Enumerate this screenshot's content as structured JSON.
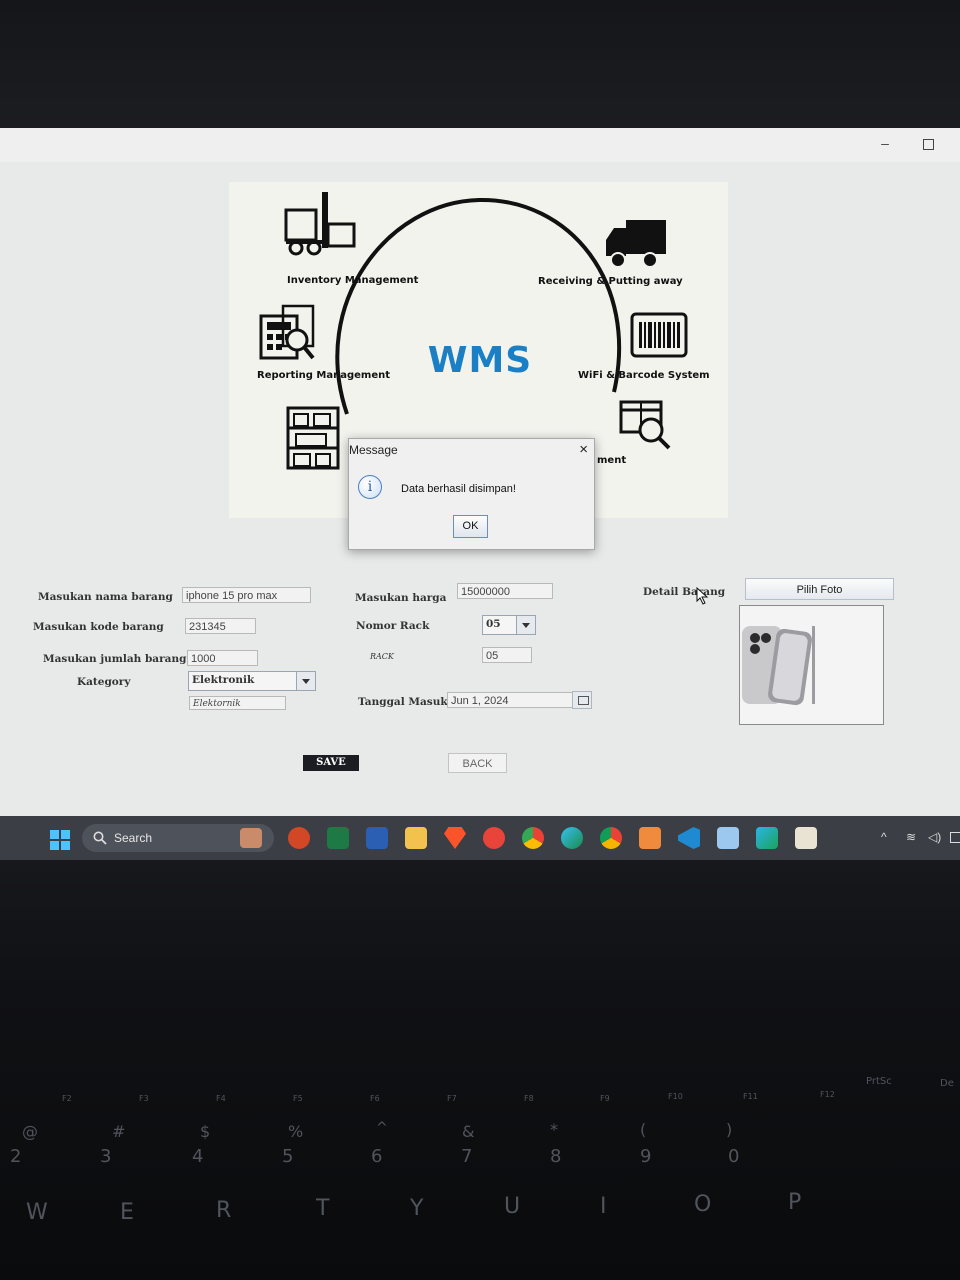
{
  "banner": {
    "title": "WMS",
    "modules": {
      "inventory": "Inventory Management",
      "receiving": "Receiving & Putting away",
      "reporting": "Reporting Management",
      "wifi": "WiFi & Barcode System",
      "partial": "ment"
    }
  },
  "dialog": {
    "title": "Message",
    "message": "Data berhasil disimpan!",
    "ok_label": "OK",
    "close_glyph": "×",
    "info_glyph": "i"
  },
  "form": {
    "nama_label": "Masukan nama barang",
    "nama_value": "iphone 15 pro max",
    "kode_label": "Masukan kode barang",
    "kode_value": "231345",
    "jumlah_label": "Masukan jumlah barang",
    "jumlah_value": "1000",
    "kategori_label": "Kategory",
    "kategori_value": "Elektronik",
    "kategori_echo": "Elektornik",
    "harga_label": "Masukan harga",
    "harga_value": "15000000",
    "nomor_rack_label": "Nomor Rack",
    "nomor_rack_value": "05",
    "rack_label": "RACK",
    "rack_value": "05",
    "tanggal_label": "Tanggal Masuk",
    "tanggal_value": "Jun 1, 2024",
    "detail_label": "Detail Barang",
    "pilih_foto_label": "Pilih Foto",
    "save_label": "SAVE",
    "back_label": "BACK"
  },
  "taskbar": {
    "search_placeholder": "Search",
    "apps": [
      "powerpoint",
      "excel",
      "word",
      "file-explorer",
      "brave",
      "wps",
      "chrome",
      "edge",
      "chrome-canary",
      "wps-sheet",
      "vscode",
      "virtualbox",
      "launcher",
      "image-viewer"
    ]
  },
  "keyboard": {
    "fn_row": [
      "F2",
      "F3",
      "F4",
      "F5",
      "F6",
      "F7",
      "F8",
      "F9",
      "F10",
      "F11",
      "F12"
    ],
    "num_row": [
      {
        "top": "@",
        "bottom": "2"
      },
      {
        "top": "#",
        "bottom": "3"
      },
      {
        "top": "$",
        "bottom": "4"
      },
      {
        "top": "%",
        "bottom": "5"
      },
      {
        "top": "^",
        "bottom": "6"
      },
      {
        "top": "&",
        "bottom": "7"
      },
      {
        "top": "*",
        "bottom": "8"
      },
      {
        "top": "(",
        "bottom": "9"
      },
      {
        "top": ")",
        "bottom": "0"
      }
    ],
    "letter_row": [
      "W",
      "E",
      "R",
      "T",
      "Y",
      "U",
      "I",
      "O",
      "P"
    ],
    "prtsc": "PrtSc",
    "del": "De"
  }
}
